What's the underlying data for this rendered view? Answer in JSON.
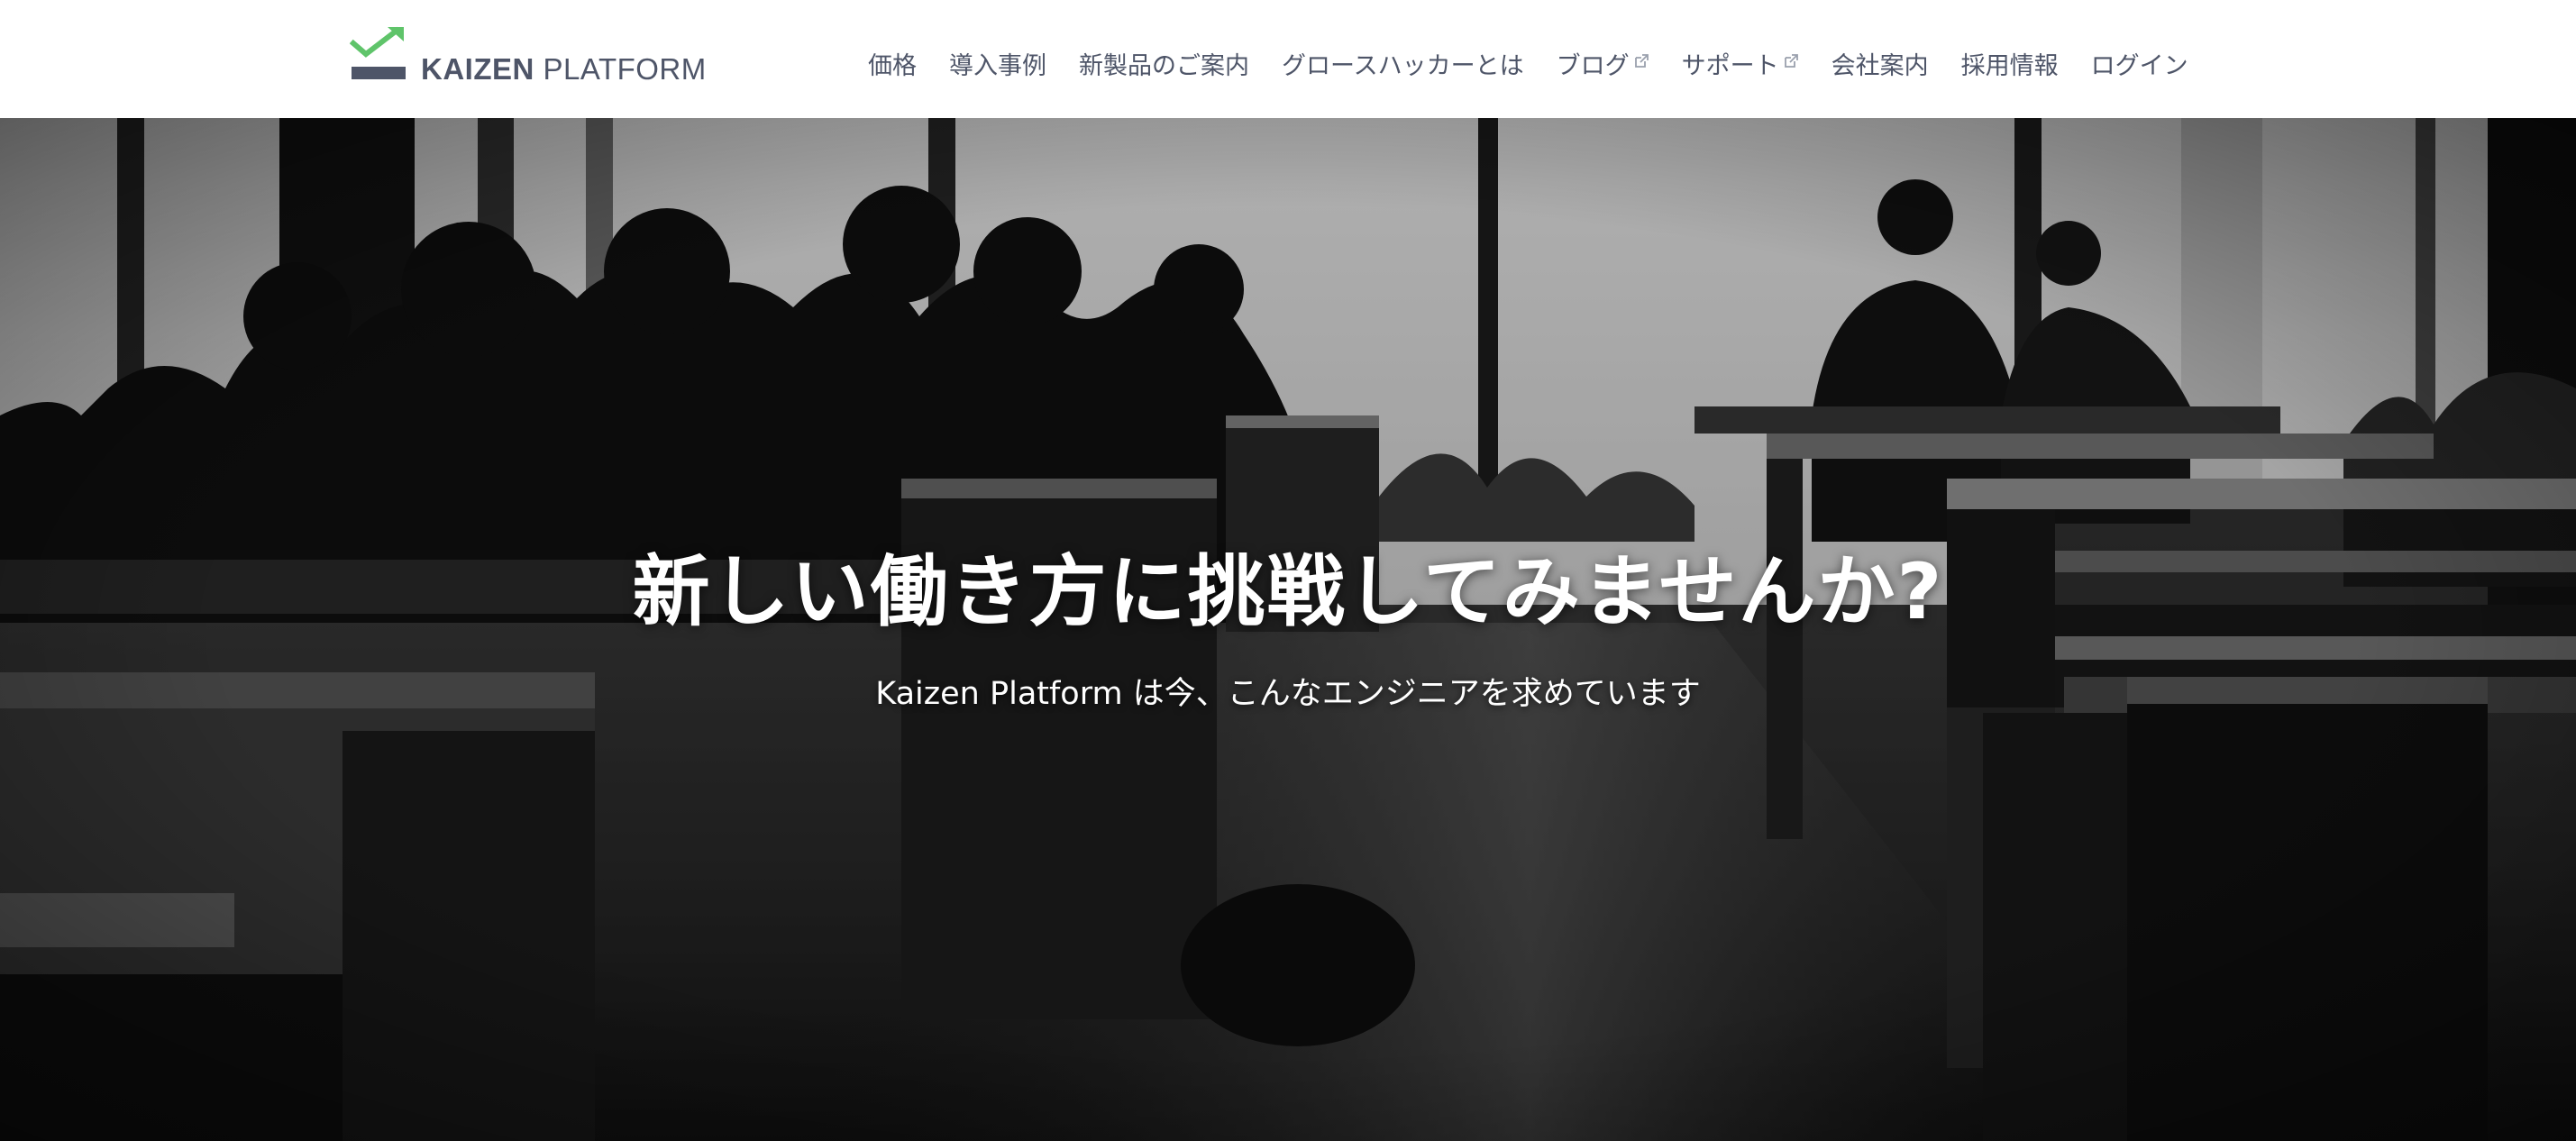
{
  "brand": {
    "name_bold": "KAIZEN",
    "name_light": "PLATFORM",
    "accent_color": "#5fc46a",
    "text_color": "#4e5568"
  },
  "nav": {
    "items": [
      {
        "label": "価格",
        "external": false
      },
      {
        "label": "導入事例",
        "external": false
      },
      {
        "label": "新製品のご案内",
        "external": false
      },
      {
        "label": "グロースハッカーとは",
        "external": false
      },
      {
        "label": "ブログ",
        "external": true,
        "icon": "external-link-icon"
      },
      {
        "label": "サポート",
        "external": true,
        "icon": "external-link-icon"
      },
      {
        "label": "会社案内",
        "external": false
      },
      {
        "label": "採用情報",
        "external": false
      },
      {
        "label": "ログイン",
        "external": false
      }
    ]
  },
  "hero": {
    "title": "新しい働き方に挑戦してみませんか?",
    "subtitle": "Kaizen Platform は今、こんなエンジニアを求めています",
    "background": "grayscale office photo with silhouettes at tables"
  }
}
